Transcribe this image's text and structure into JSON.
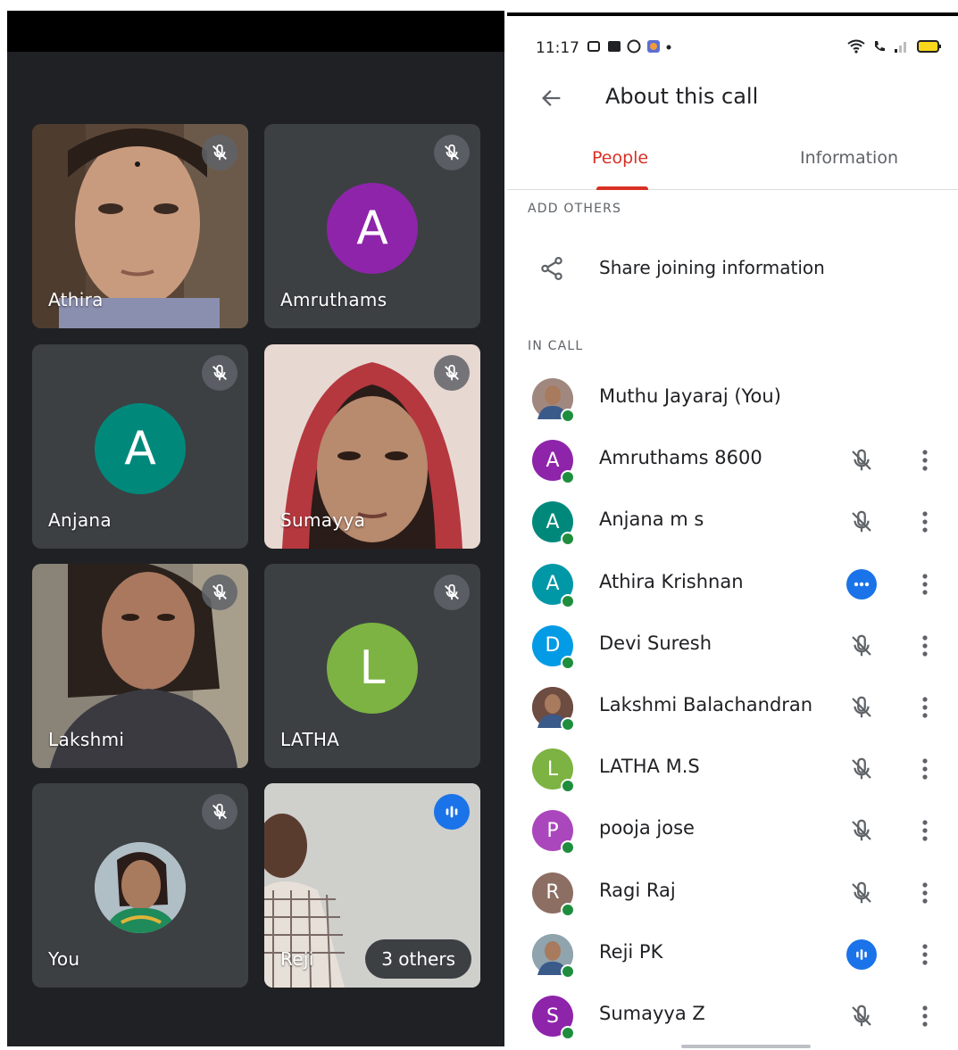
{
  "grid": {
    "tiles": [
      {
        "name": "Athira",
        "type": "video",
        "muted": true
      },
      {
        "name": "Amruthams",
        "type": "avatar",
        "initial": "A",
        "color": "#8e24aa",
        "muted": true
      },
      {
        "name": "Anjana",
        "type": "avatar",
        "initial": "A",
        "color": "#00897b",
        "muted": true
      },
      {
        "name": "Sumayya",
        "type": "video",
        "muted": true
      },
      {
        "name": "Lakshmi",
        "type": "video",
        "muted": true
      },
      {
        "name": "LATHA",
        "type": "avatar",
        "initial": "L",
        "color": "#7cb342",
        "muted": true
      },
      {
        "name": "You",
        "type": "photo-avatar",
        "muted": true
      },
      {
        "name": "Reji",
        "type": "video",
        "speaking": true,
        "others_label": "3 others"
      }
    ]
  },
  "status_bar": {
    "time": "11:17"
  },
  "appbar": {
    "title": "About this call"
  },
  "tabs": {
    "people": "People",
    "information": "Information"
  },
  "sections": {
    "add_others": "ADD OTHERS",
    "in_call": "IN CALL"
  },
  "share": {
    "label": "Share joining information"
  },
  "participants": [
    {
      "name": "Muthu Jayaraj (You)",
      "avatar": "photo",
      "color": "#a1887f",
      "mic": "none"
    },
    {
      "name": "Amruthams 8600",
      "initial": "A",
      "color": "#8e24aa",
      "mic": "muted"
    },
    {
      "name": "Anjana m s",
      "initial": "A",
      "color": "#00897b",
      "mic": "muted"
    },
    {
      "name": "Athira Krishnan",
      "initial": "A",
      "color": "#0097a7",
      "mic": "more"
    },
    {
      "name": "Devi Suresh",
      "initial": "D",
      "color": "#039be5",
      "mic": "muted"
    },
    {
      "name": "Lakshmi Balachandran",
      "avatar": "photo",
      "color": "#6d4c41",
      "mic": "muted"
    },
    {
      "name": "LATHA M.S",
      "initial": "L",
      "color": "#7cb342",
      "mic": "muted"
    },
    {
      "name": "pooja jose",
      "initial": "P",
      "color": "#ab47bc",
      "mic": "muted"
    },
    {
      "name": "Ragi Raj",
      "initial": "R",
      "color": "#8d6e63",
      "mic": "muted"
    },
    {
      "name": "Reji PK",
      "avatar": "photo",
      "color": "#90a4ae",
      "mic": "speaking"
    },
    {
      "name": "Sumayya Z",
      "initial": "S",
      "color": "#8e24aa",
      "mic": "muted"
    }
  ],
  "colors": {
    "accent": "#d93025",
    "online": "#1e8e3e",
    "blue": "#1a73e8",
    "dark_bg": "#202124"
  }
}
